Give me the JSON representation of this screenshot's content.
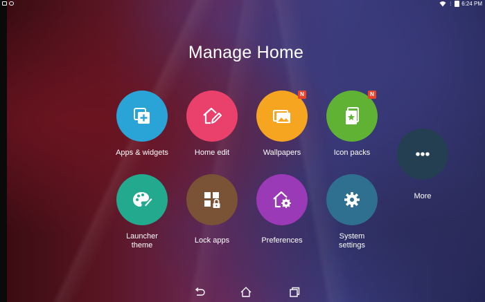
{
  "status": {
    "time": "6:24 PM"
  },
  "title": "Manage Home",
  "tiles": [
    {
      "label": "Apps & widgets",
      "color": "#2aa3d6",
      "icon": "add-widget-icon"
    },
    {
      "label": "Home edit",
      "color": "#e9416b",
      "icon": "home-edit-icon"
    },
    {
      "label": "Wallpapers",
      "color": "#f5a51f",
      "icon": "wallpaper-icon",
      "badge": "N"
    },
    {
      "label": "Icon packs",
      "color": "#5fb233",
      "icon": "icon-pack-icon",
      "badge": "N"
    },
    {
      "label": "Launcher\ntheme",
      "color": "#22a98e",
      "icon": "palette-icon"
    },
    {
      "label": "Lock apps",
      "color": "#7a5236",
      "icon": "lock-apps-icon"
    },
    {
      "label": "Preferences",
      "color": "#9b3ab6",
      "icon": "preferences-icon"
    },
    {
      "label": "System\nsettings",
      "color": "#2f6f8f",
      "icon": "gear-icon"
    },
    {
      "label": "More",
      "color": "#243e52",
      "icon": "more-icon"
    }
  ],
  "labels": {
    "t0": "Apps & widgets",
    "t1": "Home edit",
    "t2": "Wallpapers",
    "t3": "Icon packs",
    "t4a": "Launcher",
    "t4b": "theme",
    "t5": "Lock apps",
    "t6": "Preferences",
    "t7a": "System",
    "t7b": "settings",
    "t8": "More",
    "badge": "N"
  },
  "navbar": [
    "back-icon",
    "home-icon",
    "recents-icon"
  ]
}
